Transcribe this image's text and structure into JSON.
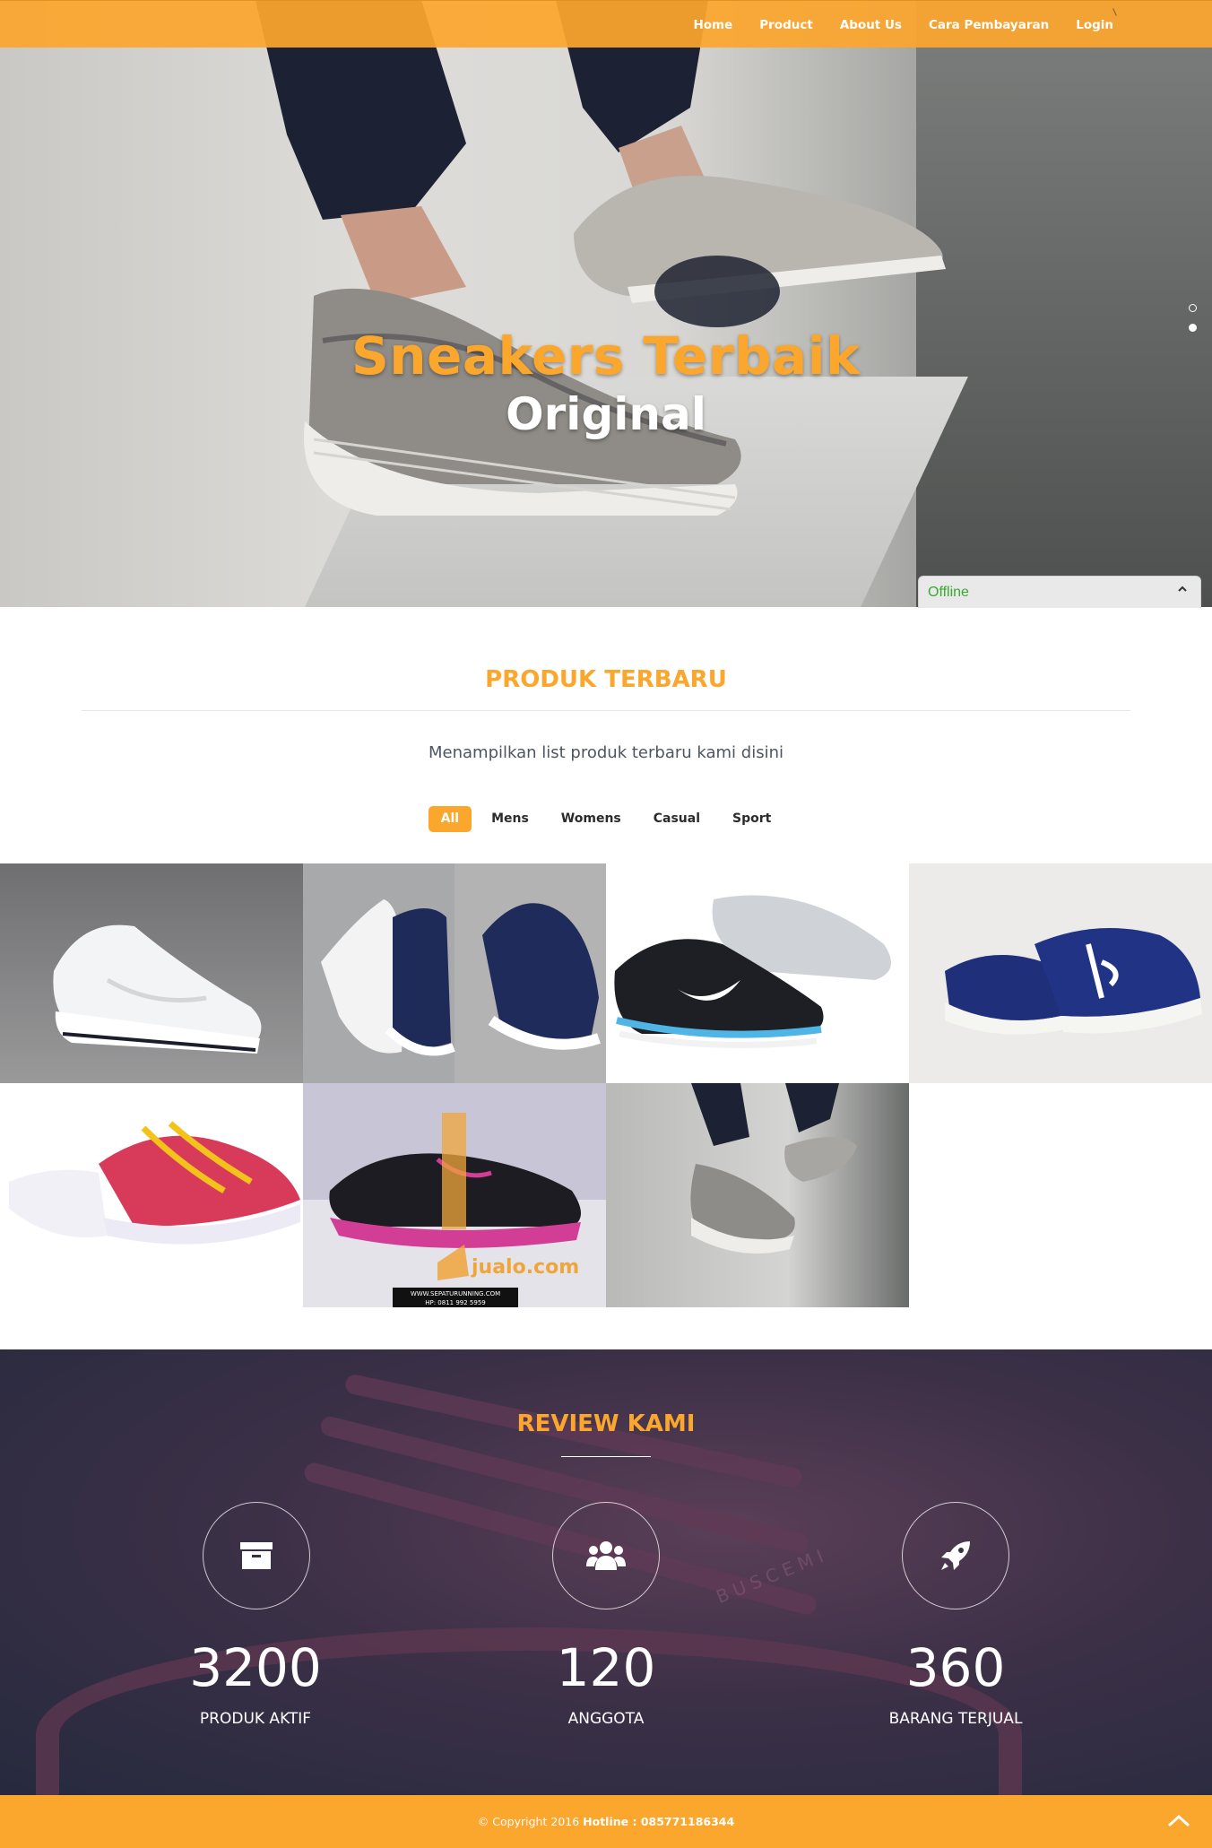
{
  "nav": {
    "items": [
      {
        "label": "Home"
      },
      {
        "label": "Product"
      },
      {
        "label": "About Us"
      },
      {
        "label": "Cara Pembayaran"
      },
      {
        "label": "Login"
      }
    ]
  },
  "hero": {
    "title": "Sneakers Terbaik",
    "subtitle": "Original",
    "slides_total": 2,
    "active_slide": 2
  },
  "chat": {
    "status": "Offline",
    "toggle_icon": "chevron-up-icon"
  },
  "products": {
    "title": "PRODUK TERBARU",
    "subtitle": "Menampilkan list produk terbaru kami disini",
    "filters": [
      {
        "label": "All",
        "active": true
      },
      {
        "label": "Mens",
        "active": false
      },
      {
        "label": "Womens",
        "active": false
      },
      {
        "label": "Casual",
        "active": false
      },
      {
        "label": "Sport",
        "active": false
      }
    ],
    "items": [
      {
        "image": "white-low-top-sneaker"
      },
      {
        "image": "navy-canvas-sneakers-pair"
      },
      {
        "image": "black-white-running-shoes"
      },
      {
        "image": "navy-canvas-sneakers"
      },
      {
        "image": "pink-yellow-slip-on"
      },
      {
        "image": "black-pink-running-shoe"
      },
      {
        "image": "grey-knit-sneakers"
      }
    ],
    "watermark": {
      "brand": "jualo.com",
      "line1": "WWW.SEPATURUNNING.COM",
      "line2": "HP: 0811 992 5959"
    }
  },
  "review": {
    "title": "REVIEW KAMI",
    "shoe_text": "BUSCEMI",
    "stats": [
      {
        "icon": "archive-icon",
        "value": "3200",
        "label": "PRODUK AKTIF"
      },
      {
        "icon": "users-icon",
        "value": "120",
        "label": "ANGGOTA"
      },
      {
        "icon": "rocket-icon",
        "value": "360",
        "label": "BARANG TERJUAL"
      }
    ]
  },
  "footer": {
    "copyright": "© Copyright 2016",
    "hotline": "Hotline : 085771186344",
    "back_to_top_icon": "chevron-up-icon"
  },
  "colors": {
    "accent": "#fba62d",
    "footer": "#fba62d",
    "review_overlay": "#2f2d44",
    "chat_status": "#3aa832"
  }
}
